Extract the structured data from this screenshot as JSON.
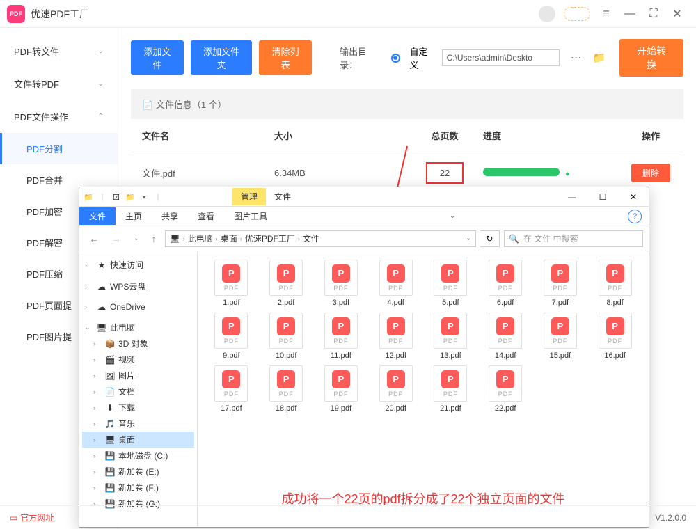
{
  "app": {
    "title": "优速PDF工厂"
  },
  "titlebar_icons": {
    "menu": "≡",
    "min": "—",
    "max": "⛶",
    "close": "✕"
  },
  "sidebar": {
    "groups": [
      {
        "label": "PDF转文件",
        "expanded": false
      },
      {
        "label": "文件转PDF",
        "expanded": false
      },
      {
        "label": "PDF文件操作",
        "expanded": true
      }
    ],
    "subs": [
      "PDF分割",
      "PDF合并",
      "PDF加密",
      "PDF解密",
      "PDF压缩",
      "PDF页面提",
      "PDF图片提"
    ]
  },
  "toolbar": {
    "add_file": "添加文件",
    "add_folder": "添加文件夹",
    "clear": "清除列表",
    "output_label": "输出目录：",
    "custom": "自定义",
    "path": "C:\\Users\\admin\\Deskto",
    "start": "开始转换"
  },
  "fileinfo": {
    "label": "文件信息（1 个）"
  },
  "table": {
    "headers": {
      "name": "文件名",
      "size": "大小",
      "pages": "总页数",
      "progress": "进度",
      "action": "操作"
    },
    "rows": [
      {
        "name": "文件.pdf",
        "size": "6.34MB",
        "pages": "22",
        "action": "删除"
      }
    ]
  },
  "explorer": {
    "manage": "管理",
    "filelabel": "文件",
    "ribbon": {
      "file": "文件",
      "home": "主页",
      "share": "共享",
      "view": "查看",
      "imgtools": "图片工具"
    },
    "path": [
      "此电脑",
      "桌面",
      "优速PDF工厂",
      "文件"
    ],
    "search_placeholder": "在 文件 中搜索",
    "tree": {
      "quick": "快速访问",
      "wps": "WPS云盘",
      "onedrive": "OneDrive",
      "thispc": "此电脑",
      "items": [
        "3D 对象",
        "视频",
        "图片",
        "文档",
        "下载",
        "音乐",
        "桌面",
        "本地磁盘 (C:)",
        "新加卷 (E:)",
        "新加卷 (F:)",
        "新加卷 (G:)"
      ]
    },
    "files": [
      "1.pdf",
      "2.pdf",
      "3.pdf",
      "4.pdf",
      "5.pdf",
      "6.pdf",
      "7.pdf",
      "8.pdf",
      "9.pdf",
      "10.pdf",
      "11.pdf",
      "12.pdf",
      "13.pdf",
      "14.pdf",
      "15.pdf",
      "16.pdf",
      "17.pdf",
      "18.pdf",
      "19.pdf",
      "20.pdf",
      "21.pdf",
      "22.pdf"
    ],
    "annotation": "成功将一个22页的pdf拆分成了22个独立页面的文件"
  },
  "footer": {
    "link": "官方网址",
    "version": "V1.2.0.0"
  }
}
